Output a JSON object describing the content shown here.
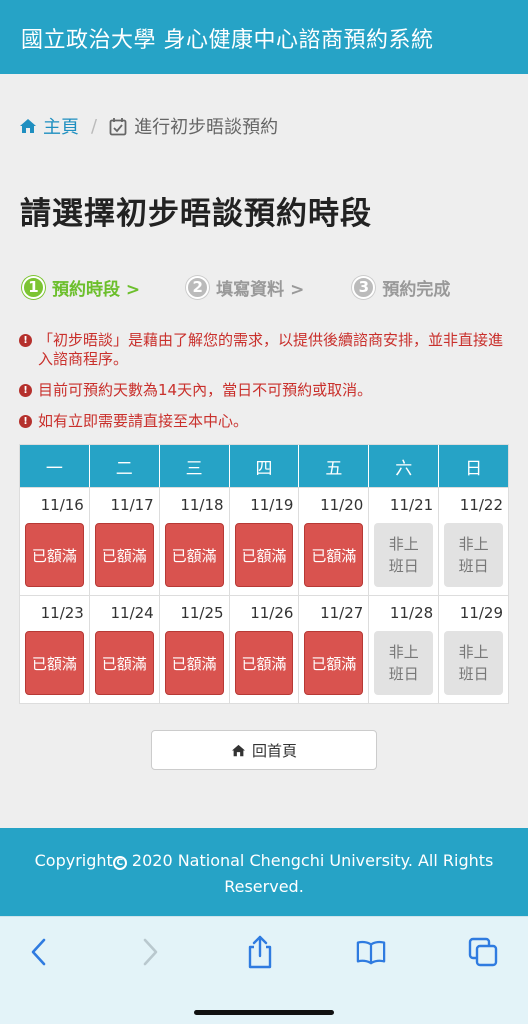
{
  "header": {
    "title": "國立政治大學 身心健康中心諮商預約系統"
  },
  "breadcrumb": {
    "home": "主頁",
    "separator": "/",
    "current": "進行初步晤談預約"
  },
  "page_title": "請選擇初步晤談預約時段",
  "steps": [
    {
      "num": "1",
      "label": "預約時段 >",
      "state": "active"
    },
    {
      "num": "2",
      "label": "填寫資料 >",
      "state": "inactive"
    },
    {
      "num": "3",
      "label": "預約完成",
      "state": "inactive"
    }
  ],
  "notices": [
    "「初步晤談」是藉由了解您的需求，以提供後續諮商安排，並非直接進入諮商程序。",
    "目前可預約天數為14天內，當日不可預約或取消。",
    "如有立即需要請直接至本中心。"
  ],
  "calendar": {
    "weekdays": [
      "一",
      "二",
      "三",
      "四",
      "五",
      "六",
      "日"
    ],
    "weeks": [
      [
        {
          "date": "11/16",
          "status": "已額滿"
        },
        {
          "date": "11/17",
          "status": "已額滿"
        },
        {
          "date": "11/18",
          "status": "已額滿"
        },
        {
          "date": "11/19",
          "status": "已額滿"
        },
        {
          "date": "11/20",
          "status": "已額滿"
        },
        {
          "date": "11/21",
          "status": "非上班日"
        },
        {
          "date": "11/22",
          "status": "非上班日"
        }
      ],
      [
        {
          "date": "11/23",
          "status": "已額滿"
        },
        {
          "date": "11/24",
          "status": "已額滿"
        },
        {
          "date": "11/25",
          "status": "已額滿"
        },
        {
          "date": "11/26",
          "status": "已額滿"
        },
        {
          "date": "11/27",
          "status": "已額滿"
        },
        {
          "date": "11/28",
          "status": "非上班日"
        },
        {
          "date": "11/29",
          "status": "非上班日"
        }
      ]
    ]
  },
  "home_button": {
    "label": "回首頁"
  },
  "footer": {
    "copyright_prefix": "Copyright",
    "copyright_suffix": " 2020 National Chengchi University. All Rights Reserved."
  },
  "browser_toolbar": {
    "icons": [
      "back-arrow-icon",
      "forward-arrow-icon",
      "share-icon",
      "bookmarks-icon",
      "tabs-icon"
    ]
  },
  "colors": {
    "header_bg": "#26a3c6",
    "active_step": "#7cc432",
    "notice_red": "#c9302c",
    "full_btn": "#d9534f",
    "off_btn": "#e2e2e2"
  }
}
